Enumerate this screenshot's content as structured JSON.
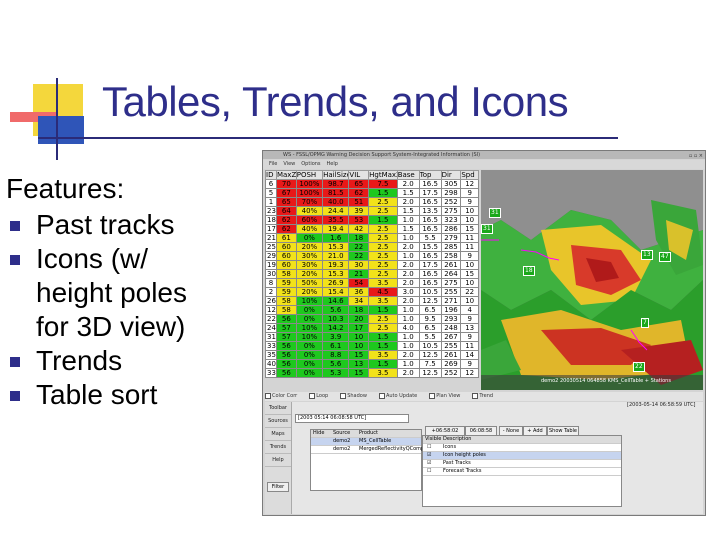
{
  "title": "Tables, Trends, and Icons",
  "features": {
    "heading": "Features:",
    "items": [
      "Past tracks",
      "Icons (w/ height poles for 3D view)",
      "Trends",
      "Table sort"
    ],
    "item_lines": [
      [
        "Past tracks"
      ],
      [
        "Icons (w/",
        "height poles",
        "for 3D view)"
      ],
      [
        "Trends"
      ],
      [
        "Table sort"
      ]
    ]
  },
  "app": {
    "title_text": "WS - FSSL/OPMG Warning Decision Support System-Integrated Information (SI)",
    "menu": [
      "File",
      "View",
      "Options",
      "Help"
    ],
    "columns": [
      "ID",
      "MaxZ",
      "POSH",
      "HailSize",
      "VIL",
      "HgtMaxZ",
      "Base",
      "Top",
      "Dir",
      "Spd"
    ],
    "rows": [
      [
        "6",
        "70",
        "100%",
        "98.7",
        "65",
        "7.5",
        "2.0",
        "16.5",
        "305",
        "12"
      ],
      [
        "5",
        "67",
        "100%",
        "81.5",
        "62",
        "1.5",
        "1.5",
        "17.5",
        "298",
        "9"
      ],
      [
        "1",
        "65",
        "70%",
        "40.0",
        "51",
        "2.5",
        "2.0",
        "16.5",
        "252",
        "9"
      ],
      [
        "23",
        "64",
        "40%",
        "24.4",
        "39",
        "2.5",
        "1.5",
        "13.5",
        "275",
        "10"
      ],
      [
        "18",
        "62",
        "60%",
        "35.5",
        "53",
        "1.5",
        "1.0",
        "16.5",
        "323",
        "10"
      ],
      [
        "17",
        "62",
        "40%",
        "19.4",
        "42",
        "2.5",
        "1.5",
        "16.5",
        "286",
        "15"
      ],
      [
        "21",
        "61",
        "0%",
        "1.6",
        "18",
        "2.5",
        "1.0",
        "5.5",
        "279",
        "11"
      ],
      [
        "25",
        "60",
        "20%",
        "15.3",
        "22",
        "2.5",
        "2.0",
        "15.5",
        "285",
        "11"
      ],
      [
        "29",
        "60",
        "30%",
        "21.0",
        "22",
        "2.5",
        "1.0",
        "16.5",
        "258",
        "9"
      ],
      [
        "19",
        "60",
        "30%",
        "19.3",
        "30",
        "2.5",
        "2.0",
        "17.5",
        "261",
        "10"
      ],
      [
        "30",
        "58",
        "20%",
        "15.3",
        "21",
        "2.5",
        "2.0",
        "16.5",
        "264",
        "15"
      ],
      [
        "8",
        "59",
        "50%",
        "26.9",
        "54",
        "3.5",
        "2.0",
        "16.5",
        "275",
        "10"
      ],
      [
        "2",
        "59",
        "20%",
        "15.4",
        "36",
        "4.5",
        "3.0",
        "10.5",
        "255",
        "22"
      ],
      [
        "26",
        "58",
        "10%",
        "14.6",
        "34",
        "3.5",
        "2.0",
        "12.5",
        "271",
        "10"
      ],
      [
        "12",
        "58",
        "0%",
        "5.6",
        "18",
        "1.5",
        "1.0",
        "6.5",
        "196",
        "4"
      ],
      [
        "22",
        "56",
        "0%",
        "10.3",
        "20",
        "2.5",
        "1.0",
        "9.5",
        "293",
        "9"
      ],
      [
        "24",
        "57",
        "10%",
        "14.2",
        "17",
        "2.5",
        "4.0",
        "6.5",
        "248",
        "13"
      ],
      [
        "31",
        "57",
        "10%",
        "3.9",
        "10",
        "1.5",
        "1.0",
        "5.5",
        "267",
        "9"
      ],
      [
        "33",
        "56",
        "0%",
        "6.1",
        "10",
        "1.5",
        "1.0",
        "10.5",
        "255",
        "11"
      ],
      [
        "35",
        "56",
        "0%",
        "8.8",
        "15",
        "3.5",
        "2.0",
        "12.5",
        "261",
        "14"
      ],
      [
        "40",
        "56",
        "0%",
        "5.6",
        "13",
        "1.5",
        "1.0",
        "7.5",
        "269",
        "9"
      ],
      [
        "33",
        "56",
        "0%",
        "5.3",
        "15",
        "3.5",
        "2.0",
        "12.5",
        "252",
        "12"
      ]
    ],
    "row_colors": {
      "red": "#e81919",
      "yellow": "#f2e21a",
      "green": "#1ec81e",
      "white": "#ffffff"
    },
    "storm_labels": [
      "31",
      "31",
      "13",
      "47",
      "18",
      "7",
      "22"
    ],
    "map_caption": "demo2 20030514 064858 KMS_CellTable + Stations",
    "controls": [
      "Color Corr",
      "Loop",
      "Shadow",
      "Auto Update",
      "Plan View",
      "Trend"
    ],
    "side_tabs": [
      "Toolbar",
      "Sources",
      "Maps",
      "Trends",
      "Help"
    ],
    "time_field": "[2003 05:14 06:08:58 UTC]",
    "status_time": "[2003-05-14 06:58:59 UTC]",
    "source_header": [
      "Hide",
      "Source",
      "Product"
    ],
    "source_rows": [
      [
        "demo2",
        "MS_CellTable"
      ],
      [
        "demo2",
        "MergedReflectivityQComposite"
      ]
    ],
    "buttons": {
      "add": "+ Add",
      "remove": "- None",
      "filter": "Filter",
      "more": "Show Table"
    },
    "time_values": [
      "+06:58:02",
      "06:08:58"
    ],
    "layer_header": [
      "Visible",
      "Description"
    ],
    "layers": [
      "Icons",
      "Icon height poles",
      "Past Tracks",
      "Forecast Tracks"
    ],
    "layer_checked": [
      false,
      true,
      true,
      false
    ]
  }
}
